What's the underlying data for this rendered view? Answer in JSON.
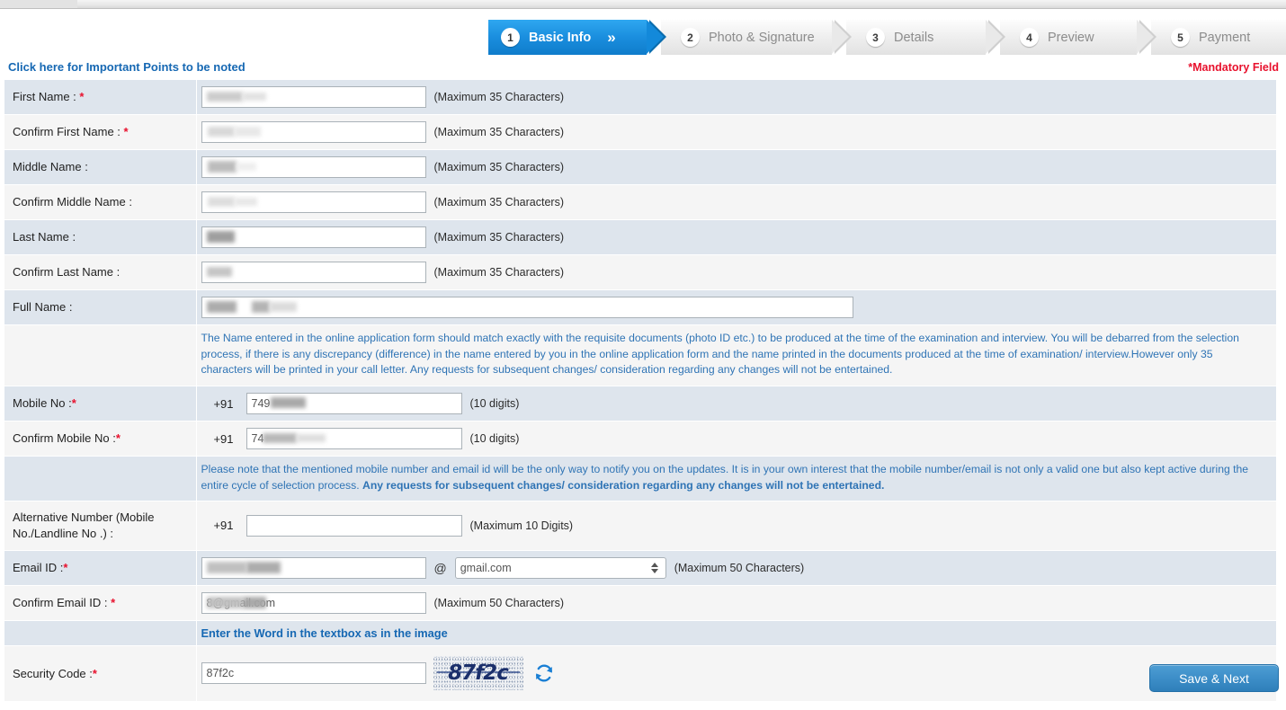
{
  "wizard": {
    "steps": [
      {
        "num": "1",
        "label": "Basic Info",
        "active": true
      },
      {
        "num": "2",
        "label": "Photo & Signature",
        "active": false
      },
      {
        "num": "3",
        "label": "Details",
        "active": false
      },
      {
        "num": "4",
        "label": "Preview",
        "active": false
      },
      {
        "num": "5",
        "label": "Payment",
        "active": false
      }
    ],
    "chevron": "»"
  },
  "header": {
    "important_link": "Click here for Important Points to be noted",
    "mandatory_note": "*Mandatory Field"
  },
  "form": {
    "labels": {
      "first_name": "First Name : ",
      "confirm_first_name": "Confirm First Name : ",
      "middle_name": "Middle Name :",
      "confirm_middle_name": "Confirm Middle Name :",
      "last_name": "Last Name :",
      "confirm_last_name": "Confirm Last Name :",
      "full_name": "Full Name :",
      "mobile_no": "Mobile No :",
      "confirm_mobile_no": "Confirm Mobile No :",
      "alternative_number": "Alternative Number (Mobile No./Landline No .) :",
      "email_id": "Email ID :",
      "confirm_email_id": "Confirm Email ID : ",
      "security_code": "Security Code :"
    },
    "hints": {
      "max35": "(Maximum 35 Characters)",
      "ten_digits": "(10 digits)",
      "max10digits": "(Maximum 10 Digits)",
      "max50": "(Maximum 50 Characters)"
    },
    "country_code": "+91",
    "at_symbol": "@",
    "values": {
      "first_name": "",
      "confirm_first_name": "",
      "middle_name": "",
      "confirm_middle_name": "",
      "last_name": "",
      "confirm_last_name": "",
      "full_name": "",
      "mobile_no": "749",
      "confirm_mobile_no": "74",
      "alternative_number": "",
      "email_id": "",
      "email_domain": "gmail.com",
      "confirm_email_id": "8@gmail.com",
      "security_code": "87f2c"
    },
    "notes": {
      "name_note": "The Name entered in the online application form should match exactly with the requisite documents (photo ID etc.) to be produced at the time of the examination and interview. You will be debarred from the selection process, if there is any discrepancy (difference) in the name entered by you in the online application form and the name printed in the documents produced at the time of examination/ interview.However only 35 characters will be printed in your call letter. Any requests for subsequent changes/ consideration regarding any changes will not be entertained.",
      "mobile_note_plain": "Please note that the mentioned mobile number and email id will be the only way to notify you on the updates.  It is in your own interest that the mobile number/email is not only a valid one but also kept active during the entire cycle of selection process. ",
      "mobile_note_bold": "Any requests for subsequent changes/ consideration regarding any changes will not be entertained.",
      "captcha_instruction": "Enter the Word in the textbox as in the image"
    },
    "captcha_text": "87f2c"
  },
  "footer": {
    "save_next": "Save & Next"
  },
  "colors": {
    "accent_blue": "#1a8ede",
    "link_blue": "#1668b3",
    "note_blue": "#2f74b5",
    "required_red": "#e8112d",
    "row_odd": "#dee5ed",
    "row_even": "#f5f5f5"
  }
}
